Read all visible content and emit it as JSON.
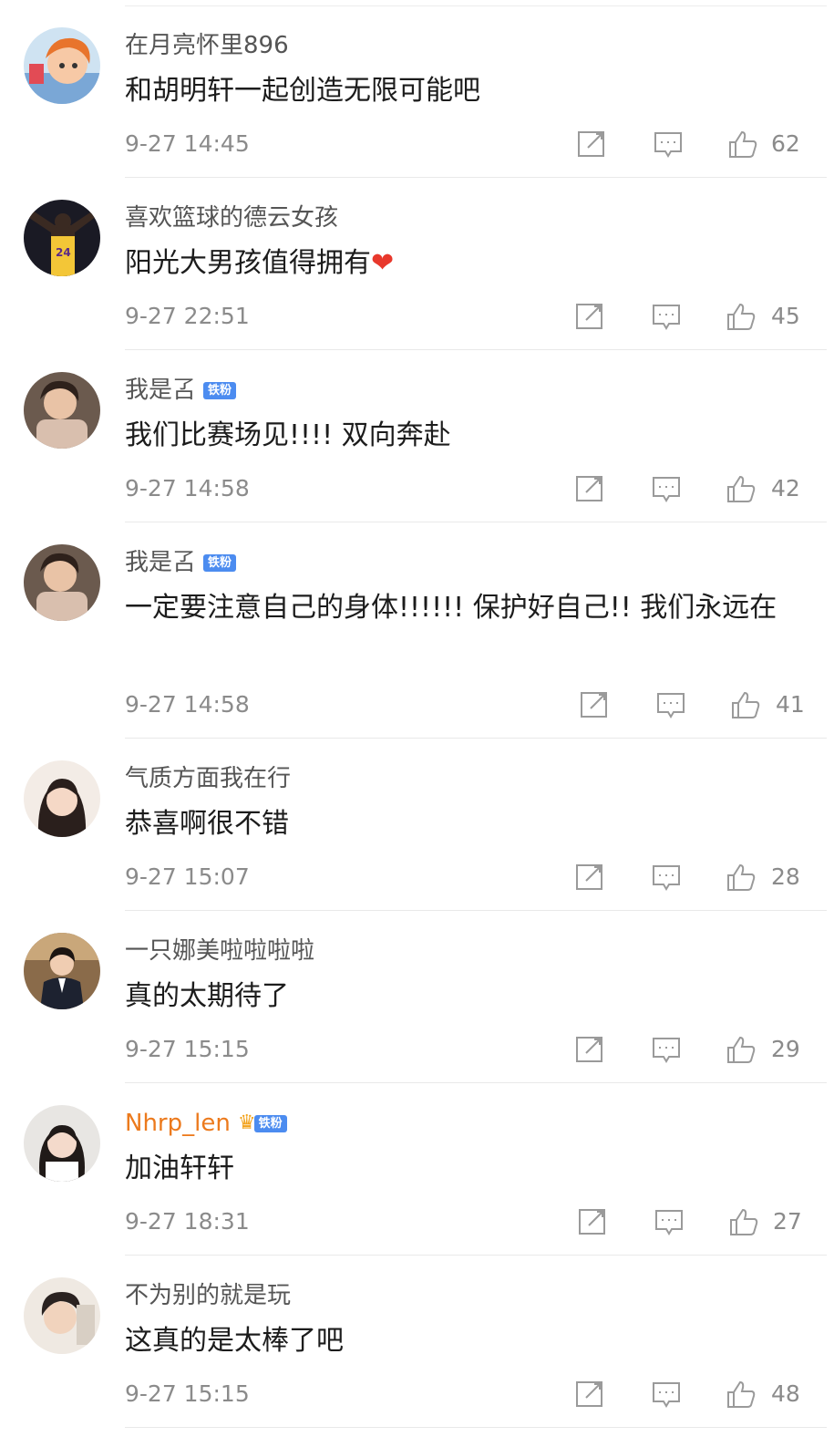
{
  "comments": [
    {
      "username": "在月亮怀里896",
      "text": "和胡明轩一起创造无限可能吧",
      "time": "9-27 14:45",
      "likes": "62",
      "avatar": "cartoon-girl-avatar"
    },
    {
      "username": "喜欢篮球的德云女孩",
      "text": "阳光大男孩值得拥有",
      "emoji": "❤",
      "time": "9-27 22:51",
      "likes": "45",
      "avatar": "basketball-player-avatar"
    },
    {
      "username": "我是叾",
      "badge": "铁粉",
      "text": "我们比赛场见!!!! 双向奔赴",
      "time": "9-27 14:58",
      "likes": "42",
      "avatar": "child-photo-avatar"
    },
    {
      "username": "我是叾",
      "badge": "铁粉",
      "text": "一定要注意自己的身体!!!!!! 保护好自己!! 我们永远在",
      "time": "9-27 14:58",
      "likes": "41",
      "avatar": "child-photo-avatar"
    },
    {
      "username": "气质方面我在行",
      "text": "恭喜啊很不错",
      "time": "9-27 15:07",
      "likes": "28",
      "avatar": "girl-portrait-avatar"
    },
    {
      "username": "一只娜美啦啦啦啦",
      "text": "真的太期待了",
      "time": "9-27 15:15",
      "likes": "29",
      "avatar": "suit-portrait-avatar"
    },
    {
      "username": "Nhrp_len",
      "badge": "铁粉",
      "crown": true,
      "text": "加油轩轩",
      "time": "9-27 18:31",
      "likes": "27",
      "avatar": "woman-portrait-avatar"
    },
    {
      "username": "不为别的就是玩",
      "text": "这真的是太棒了吧",
      "time": "9-27 15:15",
      "likes": "48",
      "avatar": "man-portrait-avatar"
    }
  ],
  "colors": {
    "vip_name": "#ec7a1d",
    "badge": "#4c8cf0",
    "heart": "#e8382c",
    "meta": "#8b8b8b"
  }
}
